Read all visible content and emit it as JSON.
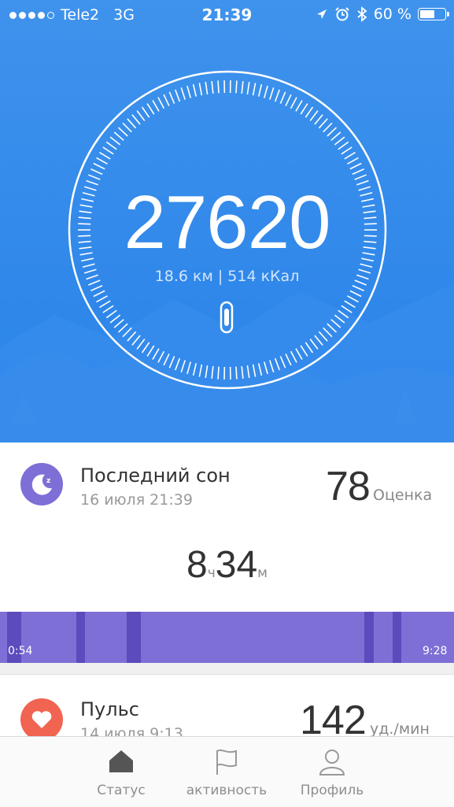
{
  "status_bar": {
    "carrier": "Tele2",
    "network": "3G",
    "time": "21:39",
    "battery": "60 %",
    "battery_level": 0.6
  },
  "steps": {
    "count": "27620",
    "summary": "18.6 км | 514 кКал"
  },
  "sleep": {
    "title": "Последний сон",
    "date": "16 июля 21:39",
    "score": "78",
    "score_label": "Оценка",
    "hours": "8",
    "hours_unit": "ч",
    "minutes": "34",
    "minutes_unit": "м",
    "start": "0:54",
    "end": "9:28"
  },
  "pulse": {
    "title": "Пульс",
    "date": "14 июля 9:13",
    "value": "142",
    "unit": "уд./мин"
  },
  "tabs": [
    {
      "label": "Статус",
      "icon": "home-icon"
    },
    {
      "label": "активность",
      "icon": "flag-icon"
    },
    {
      "label": "Профиль",
      "icon": "person-icon"
    }
  ],
  "colors": {
    "hero_blue": "#2f87ea",
    "sleep_purple": "#7e6fd6",
    "sleep_deep": "#5b4bbc",
    "pulse_red": "#f16452"
  }
}
